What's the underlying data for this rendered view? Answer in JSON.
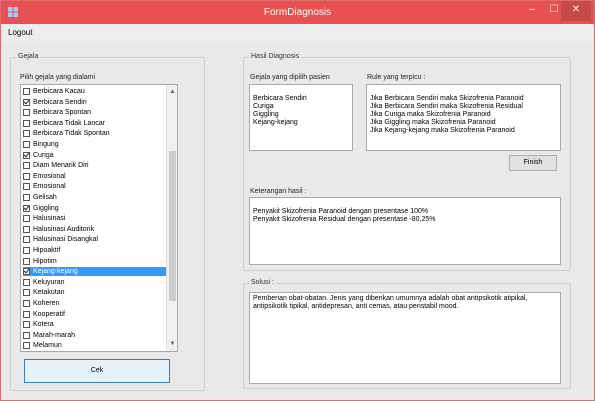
{
  "window": {
    "title": "FormDiagnosis",
    "controls": {
      "minimize": "–",
      "maximize": "☐",
      "close": "✕"
    },
    "accent": "#e85151"
  },
  "menu": {
    "logout": "Logout"
  },
  "gejala": {
    "group_title": "Gejala",
    "list_label": "Pilih gejala yang dialami",
    "items": [
      {
        "label": "Berbicara Kacau",
        "checked": false
      },
      {
        "label": "Berbicara Sendiri",
        "checked": true
      },
      {
        "label": "Berbicara Spontan",
        "checked": false
      },
      {
        "label": "Berbicara Tidak Lancar",
        "checked": false
      },
      {
        "label": "Berbicara Tidak Spontan",
        "checked": false
      },
      {
        "label": "Bingung",
        "checked": false
      },
      {
        "label": "Curiga",
        "checked": true
      },
      {
        "label": "Diam Menarik Diri",
        "checked": false
      },
      {
        "label": "Emosional",
        "checked": false
      },
      {
        "label": "Emosional",
        "checked": false
      },
      {
        "label": "Gelisah",
        "checked": false
      },
      {
        "label": "Giggling",
        "checked": true
      },
      {
        "label": "Halusinasi",
        "checked": false
      },
      {
        "label": "Halusinasi Auditorik",
        "checked": false
      },
      {
        "label": "Halusinasi Disangkal",
        "checked": false
      },
      {
        "label": "Hipoaktif",
        "checked": false
      },
      {
        "label": "Hipotim",
        "checked": false
      },
      {
        "label": "Kejang-kejang",
        "checked": true,
        "selected": true
      },
      {
        "label": "Keluyuran",
        "checked": false
      },
      {
        "label": "Ketakutan",
        "checked": false
      },
      {
        "label": "Koheren",
        "checked": false
      },
      {
        "label": "Kooperatif",
        "checked": false
      },
      {
        "label": "Kotera",
        "checked": false
      },
      {
        "label": "Marah-marah",
        "checked": false
      },
      {
        "label": "Melamun",
        "checked": false
      }
    ],
    "cek_button": "Cek"
  },
  "hasil": {
    "group_title": "Hasil Diagnosis",
    "gejala_label": "Gejala yang dipilih pasien",
    "gejala_dipilih": [
      "Berbicara Sendiri",
      "Curiga",
      "Giggling",
      "Kejang-kejang"
    ],
    "rule_label": "Rule yang terpicu :",
    "rules": [
      "Jika Berbicara Sendiri maka Skizofrenia Paranoid",
      "Jika Berbicara Sendiri maka Skizofrenia Residual",
      "Jika Curiga maka Skizofrenia Paranoid",
      "Jika Giggling maka Skizofrenia Paranoid",
      "Jika Kejang-kejang maka Skizofrenia Paranoid"
    ],
    "finish_button": "Finish",
    "keterangan_label": "Keterangan hasil :",
    "keterangan": [
      "Penyakit Skizofrenia Paranoid dengan presentase 100%",
      "Penyakit Skizofrenia Residual dengan presentase -80,25%"
    ]
  },
  "solusi": {
    "group_title": "Solusi :",
    "text": "Pemberian obat-obatan. Jenis yang diberikan umumnya adalah obat antipsikotik atipikal, antipsikotik tipikal, antidepresan, anti cemas, atau penstabil mood."
  }
}
